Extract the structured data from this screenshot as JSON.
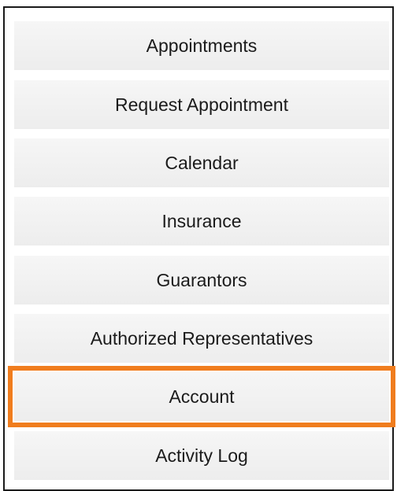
{
  "menu": {
    "items": [
      {
        "label": "Appointments"
      },
      {
        "label": "Request Appointment"
      },
      {
        "label": "Calendar"
      },
      {
        "label": "Insurance"
      },
      {
        "label": "Guarantors"
      },
      {
        "label": "Authorized Representatives"
      },
      {
        "label": "Account",
        "highlighted": true
      },
      {
        "label": "Activity Log"
      }
    ]
  },
  "colors": {
    "highlight": "#f07d1e",
    "button_bg": "#f1f1f1",
    "text": "#1b1b1b",
    "border": "#1a1a1a"
  }
}
